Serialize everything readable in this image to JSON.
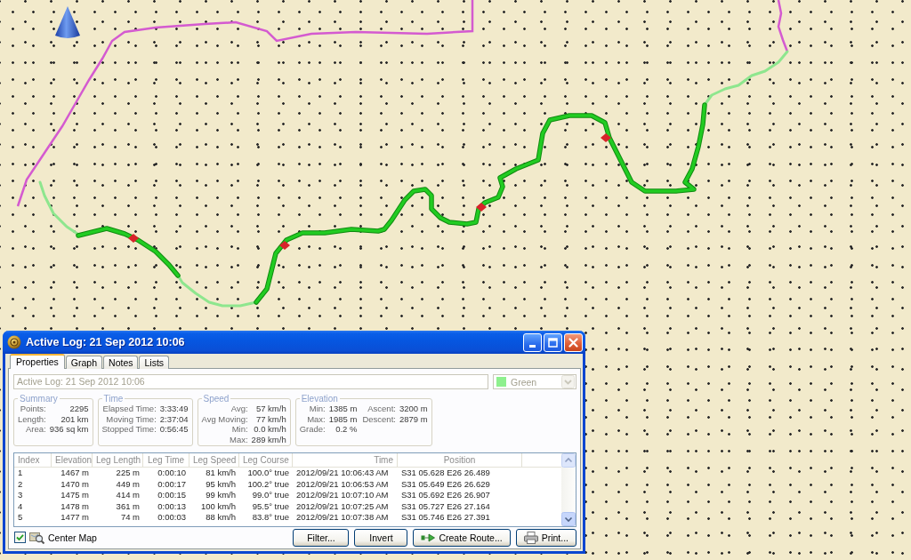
{
  "window": {
    "title": "Active Log: 21 Sep 2012 10:06"
  },
  "tabs": [
    {
      "label": "Properties",
      "selected": true
    },
    {
      "label": "Graph",
      "selected": false
    },
    {
      "label": "Notes",
      "selected": false
    },
    {
      "label": "Lists",
      "selected": false
    }
  ],
  "name_field": {
    "value": "Active Log: 21 Sep 2012 10:06",
    "disabled": true
  },
  "color_dropdown": {
    "value": "Green",
    "color": "#8ef08e",
    "disabled": true
  },
  "groups": [
    {
      "title": "Summary",
      "columns": [
        [
          {
            "label": "Points:",
            "value": "2295"
          },
          {
            "label": "Length:",
            "value": "201 km"
          },
          {
            "label": "Area:",
            "value": "936 sq km"
          }
        ]
      ]
    },
    {
      "title": "Time",
      "columns": [
        [
          {
            "label": "Elapsed Time:",
            "value": "3:33:49"
          },
          {
            "label": "Moving Time:",
            "value": "2:37:04"
          },
          {
            "label": "Stopped Time:",
            "value": "0:56:45"
          }
        ]
      ]
    },
    {
      "title": "Speed",
      "columns": [
        [
          {
            "label": "Avg:",
            "value": "57 km/h"
          },
          {
            "label": "Avg Moving:",
            "value": "77 km/h"
          },
          {
            "label": "Min:",
            "value": "0.0 km/h"
          },
          {
            "label": "Max:",
            "value": "289 km/h"
          }
        ]
      ]
    },
    {
      "title": "Elevation",
      "columns": [
        [
          {
            "label": "Min:",
            "value": "1385 m"
          },
          {
            "label": "Max:",
            "value": "1985 m"
          },
          {
            "label": "Grade:",
            "value": "0.2 %"
          }
        ],
        [
          {
            "label": "Ascent:",
            "value": "3200 m"
          },
          {
            "label": "Descent:",
            "value": "2879 m"
          }
        ]
      ]
    }
  ],
  "table": {
    "columns": [
      "Index",
      "Elevation",
      "Leg Length",
      "Leg Time",
      "Leg Speed",
      "Leg Course",
      "Time",
      "Position"
    ],
    "rows": [
      [
        "1",
        "1467 m",
        "225 m",
        "0:00:10",
        "81 km/h",
        "100.0° true",
        "2012/09/21 10:06:43 AM",
        "S31 05.628 E26 26.489"
      ],
      [
        "2",
        "1470 m",
        "449 m",
        "0:00:17",
        "95 km/h",
        "100.2° true",
        "2012/09/21 10:06:53 AM",
        "S31 05.649 E26 26.629"
      ],
      [
        "3",
        "1475 m",
        "414 m",
        "0:00:15",
        "99 km/h",
        "99.0° true",
        "2012/09/21 10:07:10 AM",
        "S31 05.692 E26 26.907"
      ],
      [
        "4",
        "1478 m",
        "361 m",
        "0:00:13",
        "100 km/h",
        "95.5° true",
        "2012/09/21 10:07:25 AM",
        "S31 05.727 E26 27.164"
      ],
      [
        "5",
        "1477 m",
        "74 m",
        "0:00:03",
        "88 km/h",
        "83.8° true",
        "2012/09/21 10:07:38 AM",
        "S31 05.746 E26 27.391"
      ]
    ]
  },
  "center_map": {
    "label": "Center Map",
    "checked": true
  },
  "buttons": [
    {
      "label": "Filter...",
      "kind": "filter"
    },
    {
      "label": "Invert",
      "kind": "invert"
    },
    {
      "label": "Create Route...",
      "kind": "route"
    },
    {
      "label": "Print...",
      "kind": "print"
    }
  ]
}
